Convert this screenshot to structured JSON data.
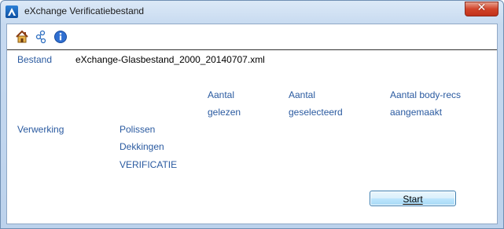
{
  "window": {
    "title": "eXchange Verificatiebestand",
    "close_glyph": "✕"
  },
  "toolbar": {
    "buttons": [
      {
        "icon": "home-icon"
      },
      {
        "icon": "network-icon"
      },
      {
        "icon": "info-icon"
      }
    ]
  },
  "form": {
    "bestand_label": "Bestand",
    "bestand_value": "eXchange-Glasbestand_2000_20140707.xml",
    "columns": {
      "gelezen_line1": "Aantal",
      "gelezen_line2": "gelezen",
      "geselecteerd_line1": "Aantal",
      "geselecteerd_line2": "geselecteerd",
      "aangemaakt_line1": "Aantal body-recs",
      "aangemaakt_line2": "aangemaakt"
    },
    "verwerking_label": "Verwerking",
    "rows": [
      "Polissen",
      "Dekkingen",
      "VERIFICATIE"
    ]
  },
  "actions": {
    "start_label": "Start"
  },
  "colors": {
    "label_blue": "#2a5aa0",
    "close_red": "#c2321b",
    "title_frame": "#c7daf0"
  }
}
